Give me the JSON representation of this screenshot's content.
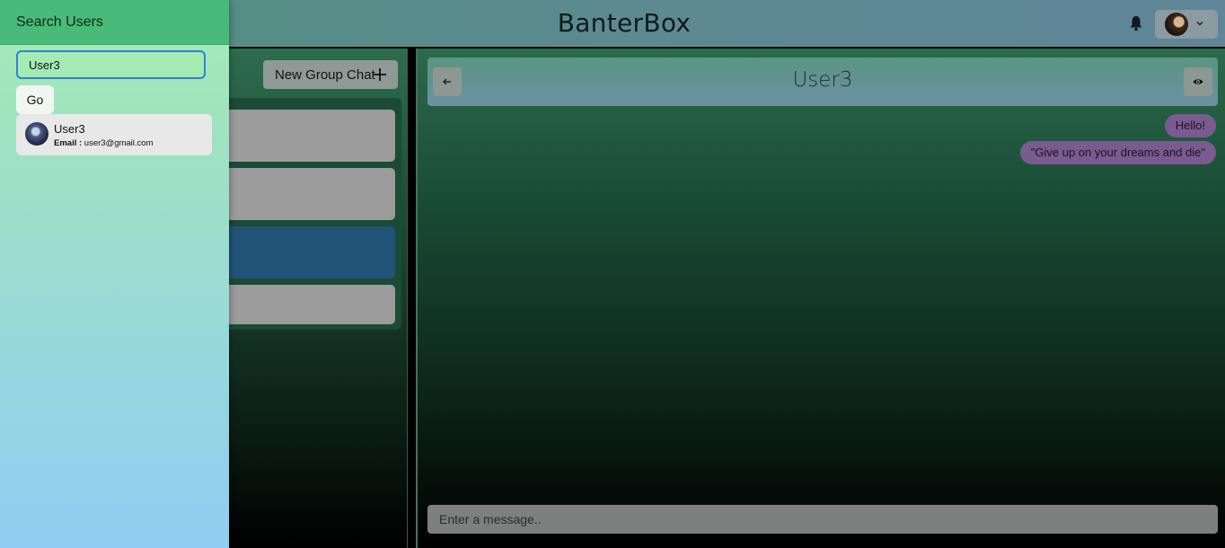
{
  "header": {
    "brand": "BanterBox"
  },
  "drawer": {
    "title": "Search Users",
    "search_value": "User3",
    "go_label": "Go",
    "results": [
      {
        "name": "User3",
        "email_label": "Email :",
        "email": "user3@gmail.com"
      }
    ]
  },
  "chats_panel": {
    "new_group_label": "New Group Chat"
  },
  "chat": {
    "title": "User3",
    "messages": [
      {
        "text": "Hello!"
      },
      {
        "text": "\"Give up on your dreams and die\""
      }
    ],
    "input_placeholder": "Enter a message.."
  },
  "colors": {
    "drawer_header": "#48bb78",
    "active_chat": "#215277",
    "message_bubble": "#7a5b8f",
    "focus_ring": "#3182ce"
  },
  "icons": [
    "bell-icon",
    "chevron-down-icon",
    "plus-icon",
    "arrow-left-icon",
    "eye-icon"
  ]
}
